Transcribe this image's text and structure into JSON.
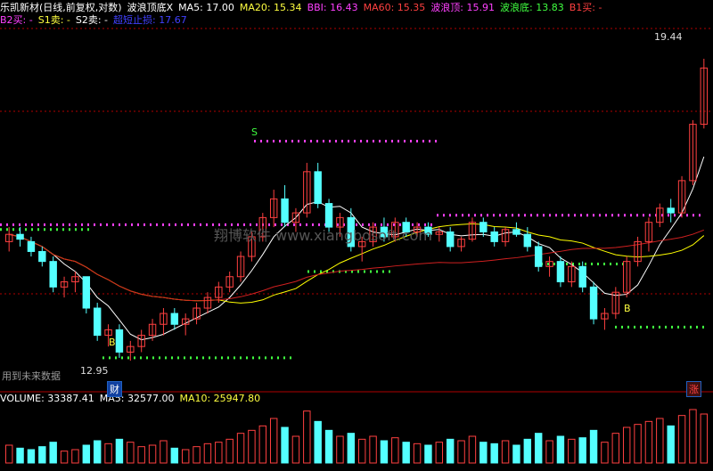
{
  "header": {
    "stock_title": "乐凯新材(日线,前复权,对数)",
    "indicator_name": "波浪顶底X",
    "ma5": "MA5: 17.00",
    "ma20": "MA20: 15.34",
    "bbi": "BBI: 16.43",
    "ma60": "MA60: 15.35",
    "wave_top": "波浪顶: 15.91",
    "wave_bottom": "波浪底: 13.83",
    "b1_buy": "B1买: -",
    "b2_buy": "B2买: -",
    "s1_sell": "S1卖: -",
    "s2_sell": "S2卖: -",
    "super_stop": "超短止损: 17.67"
  },
  "annotations": {
    "high_label": "19.44",
    "low_label": "12.95",
    "future_data_note": "用到未来数据",
    "watermark": "翔博软件 www.xiangbosoft.com",
    "finance_badge": "财",
    "rise_badge": "涨",
    "signal_s": "S",
    "signal_b": "B"
  },
  "volume_panel": {
    "volume": "VOLUME: 33387.41",
    "ma5": "MA5: 32577.00",
    "ma10": "MA10: 25947.80"
  },
  "colors": {
    "background": "#000000",
    "up": "#ff4040",
    "down": "#54ffff",
    "ma_white": "#ffffff",
    "ma_yellow": "#ffff00",
    "ma_red": "#d02020",
    "dotted_magenta": "#ff40ff",
    "dotted_green": "#40ff40",
    "grid": "#b00000"
  },
  "chart_data": {
    "type": "candlestick",
    "scale": "log",
    "price_range": [
      12.95,
      19.44
    ],
    "candles": [
      {
        "o": 15.2,
        "h": 15.5,
        "l": 15.0,
        "c": 15.35
      },
      {
        "o": 15.35,
        "h": 15.5,
        "l": 15.1,
        "c": 15.25
      },
      {
        "o": 15.2,
        "h": 15.3,
        "l": 14.9,
        "c": 15.0
      },
      {
        "o": 15.0,
        "h": 15.1,
        "l": 14.7,
        "c": 14.8
      },
      {
        "o": 14.8,
        "h": 14.9,
        "l": 14.2,
        "c": 14.3
      },
      {
        "o": 14.3,
        "h": 14.5,
        "l": 14.1,
        "c": 14.4
      },
      {
        "o": 14.4,
        "h": 14.6,
        "l": 14.2,
        "c": 14.5
      },
      {
        "o": 14.5,
        "h": 14.5,
        "l": 13.8,
        "c": 13.9
      },
      {
        "o": 13.9,
        "h": 14.0,
        "l": 13.3,
        "c": 13.4
      },
      {
        "o": 13.4,
        "h": 13.6,
        "l": 13.2,
        "c": 13.5
      },
      {
        "o": 13.5,
        "h": 13.6,
        "l": 13.0,
        "c": 13.1
      },
      {
        "o": 13.1,
        "h": 13.3,
        "l": 12.95,
        "c": 13.2
      },
      {
        "o": 13.2,
        "h": 13.5,
        "l": 13.1,
        "c": 13.4
      },
      {
        "o": 13.4,
        "h": 13.7,
        "l": 13.3,
        "c": 13.6
      },
      {
        "o": 13.6,
        "h": 13.9,
        "l": 13.4,
        "c": 13.8
      },
      {
        "o": 13.8,
        "h": 13.9,
        "l": 13.5,
        "c": 13.6
      },
      {
        "o": 13.6,
        "h": 13.8,
        "l": 13.4,
        "c": 13.7
      },
      {
        "o": 13.7,
        "h": 14.0,
        "l": 13.6,
        "c": 13.9
      },
      {
        "o": 13.9,
        "h": 14.2,
        "l": 13.8,
        "c": 14.1
      },
      {
        "o": 14.1,
        "h": 14.4,
        "l": 14.0,
        "c": 14.3
      },
      {
        "o": 14.3,
        "h": 14.6,
        "l": 14.2,
        "c": 14.5
      },
      {
        "o": 14.5,
        "h": 15.0,
        "l": 14.4,
        "c": 14.9
      },
      {
        "o": 14.9,
        "h": 15.4,
        "l": 14.8,
        "c": 15.3
      },
      {
        "o": 15.3,
        "h": 15.8,
        "l": 15.2,
        "c": 15.7
      },
      {
        "o": 15.7,
        "h": 16.3,
        "l": 15.5,
        "c": 16.1
      },
      {
        "o": 16.1,
        "h": 16.4,
        "l": 15.5,
        "c": 15.6
      },
      {
        "o": 15.6,
        "h": 15.9,
        "l": 15.4,
        "c": 15.8
      },
      {
        "o": 15.8,
        "h": 16.9,
        "l": 15.7,
        "c": 16.7
      },
      {
        "o": 16.7,
        "h": 16.9,
        "l": 15.9,
        "c": 16.0
      },
      {
        "o": 16.0,
        "h": 16.1,
        "l": 15.4,
        "c": 15.5
      },
      {
        "o": 15.5,
        "h": 15.8,
        "l": 15.3,
        "c": 15.7
      },
      {
        "o": 15.7,
        "h": 15.9,
        "l": 15.0,
        "c": 15.1
      },
      {
        "o": 15.1,
        "h": 15.3,
        "l": 14.8,
        "c": 15.2
      },
      {
        "o": 15.2,
        "h": 15.6,
        "l": 15.1,
        "c": 15.5
      },
      {
        "o": 15.5,
        "h": 15.7,
        "l": 15.2,
        "c": 15.3
      },
      {
        "o": 15.3,
        "h": 15.7,
        "l": 15.2,
        "c": 15.6
      },
      {
        "o": 15.6,
        "h": 15.7,
        "l": 15.3,
        "c": 15.4
      },
      {
        "o": 15.4,
        "h": 15.6,
        "l": 15.3,
        "c": 15.5
      },
      {
        "o": 15.5,
        "h": 15.6,
        "l": 15.3,
        "c": 15.35
      },
      {
        "o": 15.35,
        "h": 15.5,
        "l": 15.2,
        "c": 15.4
      },
      {
        "o": 15.4,
        "h": 15.5,
        "l": 15.0,
        "c": 15.1
      },
      {
        "o": 15.1,
        "h": 15.3,
        "l": 15.0,
        "c": 15.25
      },
      {
        "o": 15.25,
        "h": 15.7,
        "l": 15.2,
        "c": 15.6
      },
      {
        "o": 15.6,
        "h": 15.7,
        "l": 15.3,
        "c": 15.4
      },
      {
        "o": 15.4,
        "h": 15.5,
        "l": 15.1,
        "c": 15.2
      },
      {
        "o": 15.2,
        "h": 15.5,
        "l": 15.1,
        "c": 15.45
      },
      {
        "o": 15.45,
        "h": 15.6,
        "l": 15.3,
        "c": 15.35
      },
      {
        "o": 15.35,
        "h": 15.5,
        "l": 15.0,
        "c": 15.1
      },
      {
        "o": 15.1,
        "h": 15.2,
        "l": 14.6,
        "c": 14.7
      },
      {
        "o": 14.7,
        "h": 14.9,
        "l": 14.5,
        "c": 14.8
      },
      {
        "o": 14.8,
        "h": 14.9,
        "l": 14.3,
        "c": 14.4
      },
      {
        "o": 14.4,
        "h": 14.8,
        "l": 14.3,
        "c": 14.7
      },
      {
        "o": 14.7,
        "h": 14.8,
        "l": 14.2,
        "c": 14.3
      },
      {
        "o": 14.3,
        "h": 14.4,
        "l": 13.6,
        "c": 13.7
      },
      {
        "o": 13.7,
        "h": 13.9,
        "l": 13.5,
        "c": 13.8
      },
      {
        "o": 13.8,
        "h": 14.3,
        "l": 13.7,
        "c": 14.2
      },
      {
        "o": 14.2,
        "h": 14.9,
        "l": 14.1,
        "c": 14.8
      },
      {
        "o": 14.8,
        "h": 15.3,
        "l": 14.7,
        "c": 15.2
      },
      {
        "o": 15.2,
        "h": 15.7,
        "l": 15.0,
        "c": 15.6
      },
      {
        "o": 15.6,
        "h": 16.0,
        "l": 15.5,
        "c": 15.9
      },
      {
        "o": 15.9,
        "h": 16.1,
        "l": 15.6,
        "c": 15.8
      },
      {
        "o": 15.8,
        "h": 16.6,
        "l": 15.7,
        "c": 16.5
      },
      {
        "o": 16.5,
        "h": 17.9,
        "l": 16.4,
        "c": 17.8
      },
      {
        "o": 17.8,
        "h": 19.44,
        "l": 17.7,
        "c": 19.2
      }
    ],
    "volume": [
      12,
      10,
      9,
      11,
      14,
      8,
      9,
      12,
      15,
      13,
      16,
      14,
      11,
      12,
      15,
      10,
      9,
      11,
      13,
      14,
      16,
      20,
      22,
      25,
      30,
      24,
      18,
      35,
      28,
      22,
      18,
      20,
      16,
      18,
      15,
      17,
      14,
      13,
      12,
      14,
      16,
      15,
      18,
      14,
      13,
      15,
      12,
      16,
      20,
      15,
      18,
      16,
      17,
      22,
      14,
      20,
      24,
      26,
      28,
      30,
      25,
      32,
      36,
      33
    ]
  }
}
